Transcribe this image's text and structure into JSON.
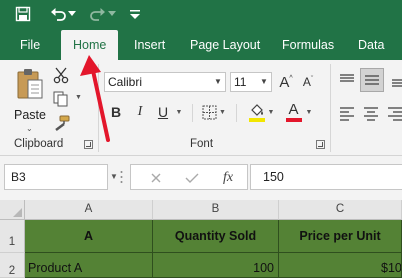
{
  "quick_access": {
    "save_icon": "save-icon",
    "undo_icon": "undo-icon",
    "redo_icon": "redo-icon",
    "customize_icon": "customize-qat-icon"
  },
  "tabs": [
    {
      "label": "File"
    },
    {
      "label": "Home"
    },
    {
      "label": "Insert"
    },
    {
      "label": "Page Layout"
    },
    {
      "label": "Formulas"
    },
    {
      "label": "Data"
    }
  ],
  "ribbon": {
    "clipboard": {
      "paste_label": "Paste",
      "group_label": "Clipboard"
    },
    "font": {
      "font_name": "Calibri",
      "font_size": "11",
      "bold": "B",
      "italic": "I",
      "underline": "U",
      "grow": "A",
      "shrink": "A",
      "font_color_letter": "A",
      "group_label": "Font"
    }
  },
  "formula_bar": {
    "name_box": "B3",
    "fx": "fx",
    "formula": "150"
  },
  "grid": {
    "columns": [
      "A",
      "B",
      "C"
    ],
    "rows": [
      "1",
      "2"
    ],
    "row1": [
      "A",
      "Quantity Sold",
      "Price per Unit"
    ],
    "row2": [
      "Product A",
      "100",
      "$10"
    ]
  },
  "colors": {
    "excel_green": "#217346",
    "cell_fill": "#548235",
    "annotation_red": "#e3162b"
  }
}
